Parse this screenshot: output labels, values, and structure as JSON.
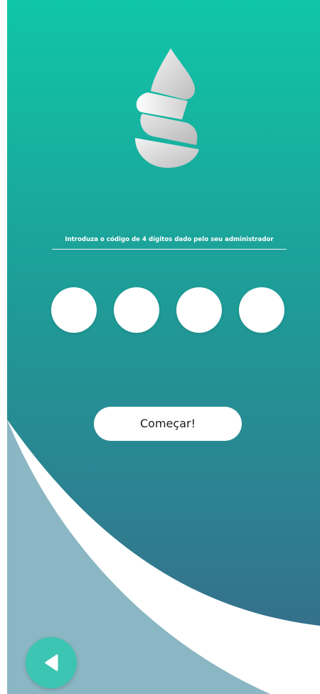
{
  "colors": {
    "gradient_top": "#10c6a8",
    "gradient_bottom": "#35718c",
    "wave_light": "#8bb6c3",
    "back_button": "#3cc5b2",
    "white": "#ffffff"
  },
  "icons": {
    "logo": "gray-droplet-logo-icon",
    "back": "triangle-left-icon"
  },
  "pin": {
    "prompt": "Introduza o código de 4 dígitos dado pelo seu administrador",
    "digits": [
      "",
      "",
      "",
      ""
    ]
  },
  "actions": {
    "start_label": "Começar!"
  }
}
